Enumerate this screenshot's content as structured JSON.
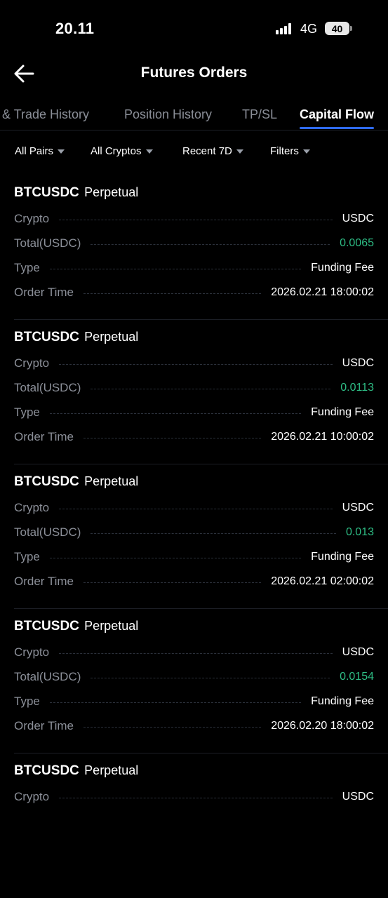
{
  "status_bar": {
    "time": "20.11",
    "network": "4G",
    "battery": "40"
  },
  "header": {
    "title": "Futures Orders"
  },
  "tabs": [
    {
      "label": "Order & Trade History",
      "active": false
    },
    {
      "label": "Position History",
      "active": false
    },
    {
      "label": "TP/SL",
      "active": false
    },
    {
      "label": "Capital Flow",
      "active": true
    }
  ],
  "filters": [
    {
      "label": "All Pairs"
    },
    {
      "label": "All Cryptos"
    },
    {
      "label": "Recent 7D"
    },
    {
      "label": "Filters"
    }
  ],
  "colors": {
    "background": "#000000",
    "accent": "#2f6bf5",
    "positive": "#2ebd85",
    "muted_text": "#8b8f98"
  },
  "records": [
    {
      "pair": "BTCUSDC",
      "contract": "Perpetual",
      "crypto_label": "Crypto",
      "crypto": "USDC",
      "total_label": "Total(USDC)",
      "total": "0.0065",
      "type_label": "Type",
      "type": "Funding Fee",
      "time_label": "Order Time",
      "time": "2026.02.21 18:00:02"
    },
    {
      "pair": "BTCUSDC",
      "contract": "Perpetual",
      "crypto_label": "Crypto",
      "crypto": "USDC",
      "total_label": "Total(USDC)",
      "total": "0.0113",
      "type_label": "Type",
      "type": "Funding Fee",
      "time_label": "Order Time",
      "time": "2026.02.21 10:00:02"
    },
    {
      "pair": "BTCUSDC",
      "contract": "Perpetual",
      "crypto_label": "Crypto",
      "crypto": "USDC",
      "total_label": "Total(USDC)",
      "total": "0.013",
      "type_label": "Type",
      "type": "Funding Fee",
      "time_label": "Order Time",
      "time": "2026.02.21 02:00:02"
    },
    {
      "pair": "BTCUSDC",
      "contract": "Perpetual",
      "crypto_label": "Crypto",
      "crypto": "USDC",
      "total_label": "Total(USDC)",
      "total": "0.0154",
      "type_label": "Type",
      "type": "Funding Fee",
      "time_label": "Order Time",
      "time": "2026.02.20 18:00:02"
    },
    {
      "pair": "BTCUSDC",
      "contract": "Perpetual",
      "crypto_label": "Crypto",
      "crypto": "USDC"
    }
  ]
}
